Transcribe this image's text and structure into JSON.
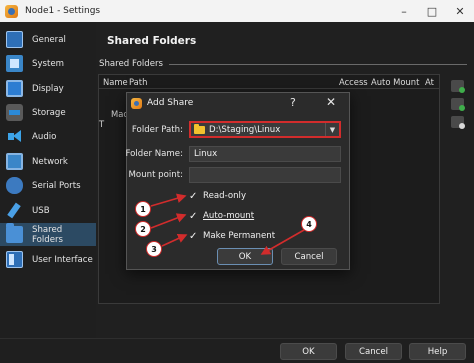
{
  "window": {
    "title": "Node1 - Settings",
    "controls": [
      "–",
      "□",
      "✕"
    ]
  },
  "sidebar": {
    "items": [
      {
        "label": "General",
        "icon": "general-icon"
      },
      {
        "label": "System",
        "icon": "system-icon"
      },
      {
        "label": "Display",
        "icon": "display-icon"
      },
      {
        "label": "Storage",
        "icon": "storage-icon"
      },
      {
        "label": "Audio",
        "icon": "audio-icon"
      },
      {
        "label": "Network",
        "icon": "network-icon"
      },
      {
        "label": "Serial Ports",
        "icon": "serial-ports-icon"
      },
      {
        "label": "USB",
        "icon": "usb-icon"
      },
      {
        "label": "Shared Folders",
        "icon": "shared-folders-icon",
        "active": true
      },
      {
        "label": "User Interface",
        "icon": "user-interface-icon"
      }
    ]
  },
  "main": {
    "title": "Shared Folders",
    "group_label": "Shared Folders",
    "columns": [
      "Name",
      "Path",
      "Access",
      "Auto Mount",
      "At"
    ],
    "rows": [
      "Machine Folders",
      "T"
    ]
  },
  "dialog": {
    "title": "Add Share",
    "help": "?",
    "close": "✕",
    "folder_path_label": "Folder Path:",
    "folder_path_value": "D:\\Staging\\Linux",
    "folder_name_label": "Folder Name:",
    "folder_name_value": "Linux",
    "mount_point_label": "Mount point:",
    "mount_point_value": "",
    "read_only": {
      "label": "Read-only",
      "checked": true,
      "mark": "✓"
    },
    "auto_mount": {
      "label": "Auto-mount",
      "checked": true,
      "mark": "✓"
    },
    "make_permanent": {
      "label": "Make Permanent",
      "checked": true,
      "mark": "✓"
    },
    "ok_label": "OK",
    "cancel_label": "Cancel"
  },
  "markers": [
    "1",
    "2",
    "3",
    "4"
  ],
  "footer": {
    "ok_label": "OK",
    "cancel_label": "Cancel",
    "help_label": "Help"
  },
  "colors": {
    "accent_red": "#d22c2c",
    "selection": "#2c4a63",
    "folder": "#f2c12e"
  }
}
